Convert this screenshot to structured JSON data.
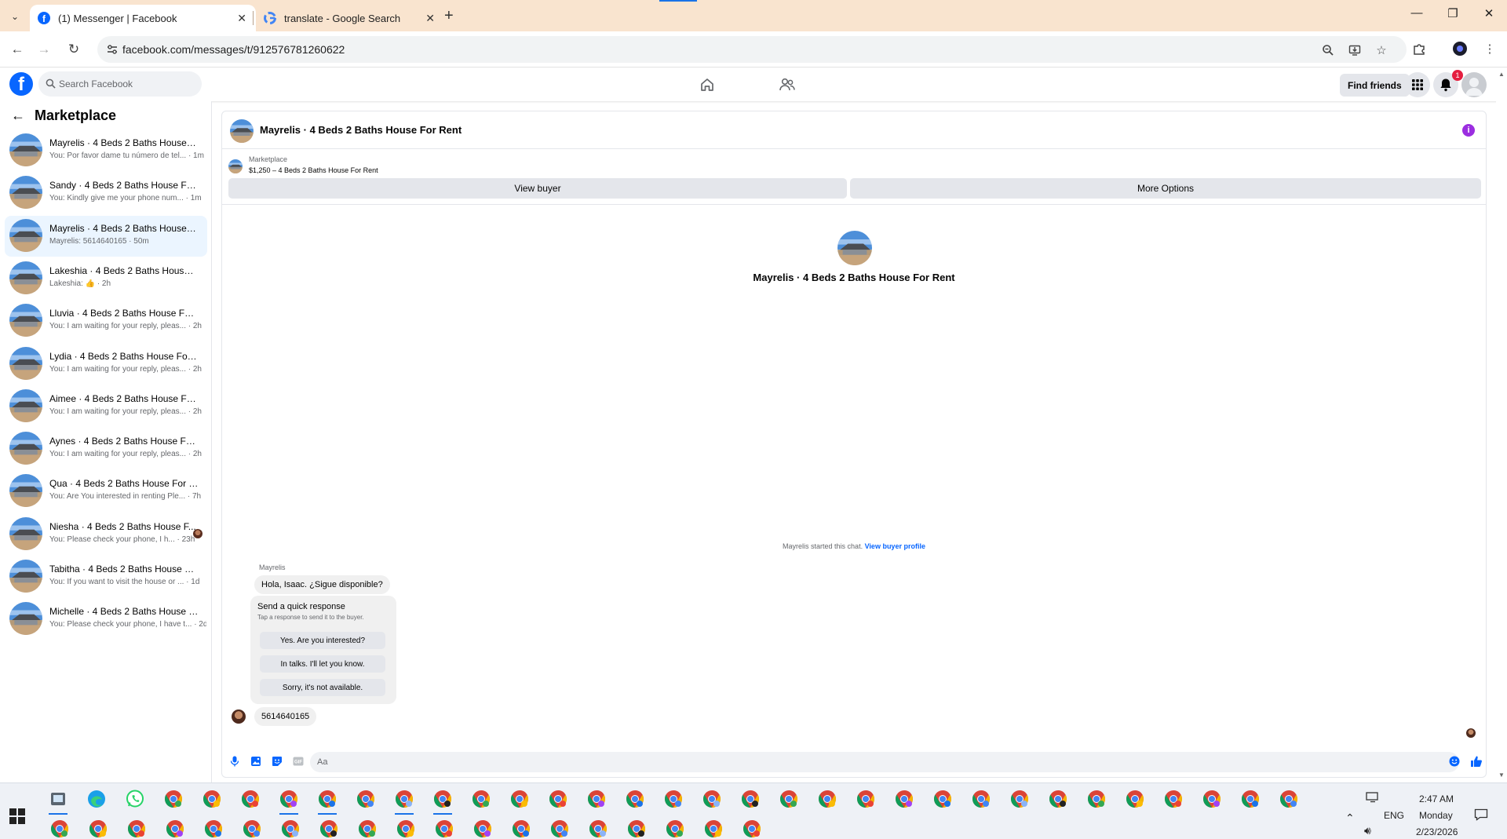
{
  "browser": {
    "tabs": [
      {
        "title": "(1) Messenger | Facebook",
        "active": true
      },
      {
        "title": "translate - Google Search",
        "active": false
      }
    ],
    "url": "facebook.com/messages/t/912576781260622"
  },
  "facebook": {
    "search_placeholder": "Search Facebook",
    "find_friends_label": "Find friends",
    "notification_count": "1",
    "brand_color": "#0866ff"
  },
  "sidebar": {
    "title": "Marketplace",
    "conversations": [
      {
        "title": "Mayrelis · 4 Beds 2 Baths House F...",
        "snippet": "You: Por favor dame tu número de tel... · 1m"
      },
      {
        "title": "Sandy · 4 Beds 2 Baths House For ...",
        "snippet": "You: Kindly give me your phone num... · 1m"
      },
      {
        "title": "Mayrelis · 4 Beds 2 Baths House F...",
        "snippet": "Mayrelis: 5614640165 · 50m"
      },
      {
        "title": "Lakeshia · 4 Beds 2 Baths House F...",
        "snippet": "Lakeshia: 👍 · 2h"
      },
      {
        "title": "Lluvia · 4 Beds 2 Baths House For ...",
        "snippet": "You: I am waiting for your reply, pleas... · 2h"
      },
      {
        "title": "Lydia · 4 Beds 2 Baths House For R...",
        "snippet": "You: I am waiting for your reply, pleas... · 2h"
      },
      {
        "title": "Aimee · 4 Beds 2 Baths House For ...",
        "snippet": "You: I am waiting for your reply, pleas... · 2h"
      },
      {
        "title": "Aynes · 4 Beds 2 Baths House For ...",
        "snippet": "You: I am waiting for your reply, pleas... · 2h"
      },
      {
        "title": "Qua · 4 Beds 2 Baths House For Rent",
        "snippet": "You: Are You interested in renting Ple... · 7h"
      },
      {
        "title": "Niesha · 4 Beds 2 Baths House F...",
        "snippet": "You: Please check your phone, I h... · 23h"
      },
      {
        "title": "Tabitha · 4 Beds 2 Baths House For...",
        "snippet": "You: If you want to visit the house or ... · 1d"
      },
      {
        "title": "Michelle · 4 Beds 2 Baths House F...",
        "snippet": "You: Please check your phone, I have t... · 2d"
      }
    ]
  },
  "chat": {
    "header_name": "Mayrelis · 4 Beds 2 Baths House For Rent",
    "listing_category": "Marketplace",
    "listing_price": "$1,250 – 4 Beds 2 Baths House For Rent",
    "view_buyer_label": "View buyer",
    "more_options_label": "More Options",
    "center_name": "Mayrelis · 4 Beds 2 Baths House For Rent",
    "started_text": "Mayrelis started this chat.",
    "view_profile_link": "View buyer profile",
    "sender_name": "Mayrelis",
    "first_message": "Hola, Isaac. ¿Sigue disponible?",
    "quick_response": {
      "title": "Send a quick response",
      "subtitle": "Tap a response to send it to the buyer.",
      "options": [
        "Yes. Are you interested?",
        "In talks. I'll let you know.",
        "Sorry, it's not available."
      ]
    },
    "phone_message": "5614640165",
    "composer_placeholder": "Aa"
  },
  "taskbar": {
    "time": "2:47 AM",
    "day": "Monday",
    "date": "2/23/2026",
    "language": "ENG"
  }
}
